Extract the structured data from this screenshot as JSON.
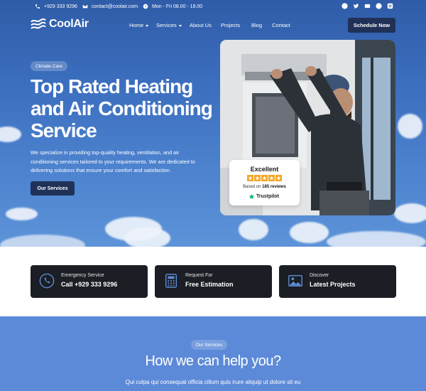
{
  "topbar": {
    "phone": "+929 333 9296",
    "email": "contact@coolair.com",
    "hours": "Mon - Fri 08.00 - 18.00",
    "social_icons": [
      "facebook-icon",
      "twitter-icon",
      "youtube-icon",
      "pinterest-icon",
      "instagram-icon"
    ]
  },
  "header": {
    "logo_text": "CoolAir",
    "nav": [
      {
        "label": "Home",
        "has_dropdown": true
      },
      {
        "label": "Services",
        "has_dropdown": true
      },
      {
        "label": "About Us",
        "has_dropdown": false
      },
      {
        "label": "Projects",
        "has_dropdown": false
      },
      {
        "label": "Blog",
        "has_dropdown": false
      },
      {
        "label": "Contact",
        "has_dropdown": false
      }
    ],
    "cta_label": "Schedule Now"
  },
  "hero": {
    "badge": "Climate Care",
    "title": "Top Rated Heating and Air Conditioning Service",
    "description": "We specialize in providing top-quality heating, ventilation, and air conditioning services tailored to your requirements. We are dedicated to delivering solutions that ensure your comfort and satisfaction.",
    "button_label": "Our Services",
    "review": {
      "title": "Excellent",
      "stars": 5,
      "based_on_prefix": "Based on",
      "reviews_count": "185 reviews",
      "brand": "Trustpilot"
    }
  },
  "features": [
    {
      "icon": "phone-icon",
      "label": "Emergency Service",
      "value": "Call +929 333 9296"
    },
    {
      "icon": "calculator-icon",
      "label": "Request For",
      "value": "Free Estimation"
    },
    {
      "icon": "image-icon",
      "label": "Discover",
      "value": "Latest Projects"
    }
  ],
  "services": {
    "badge": "Our Services",
    "title": "How we can help you?",
    "description": "Qui culpa qui consequat officia cillum quis irure aliquip ut dolore sit eu"
  },
  "colors": {
    "hero_bg": "#3c6fbf",
    "dark_button": "#1f3157",
    "card_bg": "#1b1e24",
    "services_bg": "#5d8ad8",
    "star": "#f3a625",
    "trustpilot": "#00b67a"
  }
}
